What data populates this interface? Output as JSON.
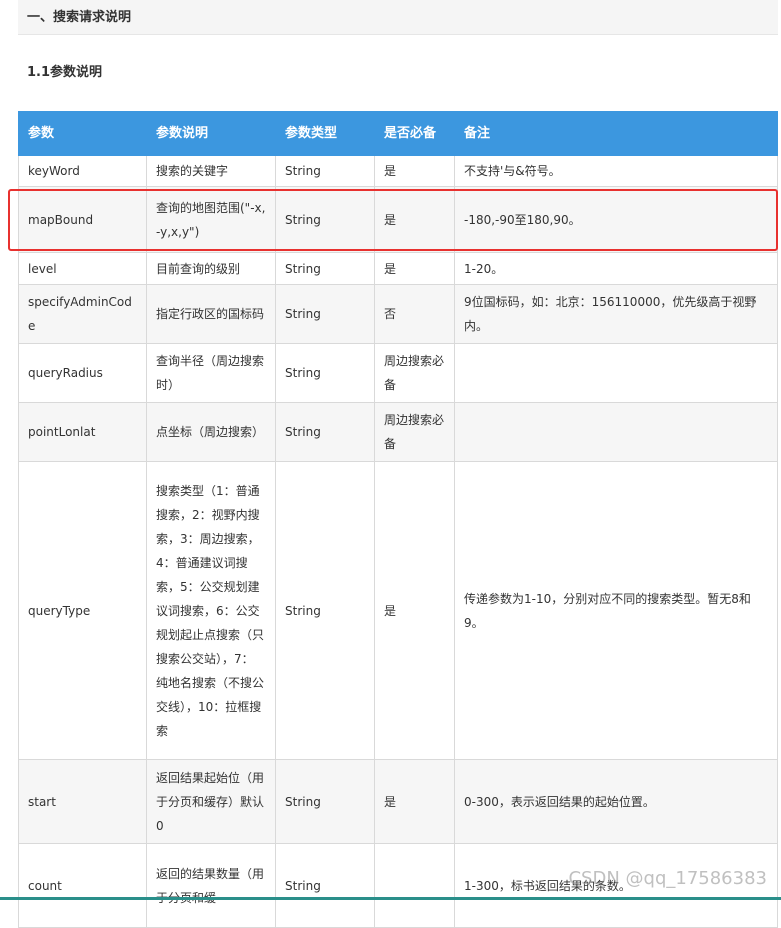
{
  "section_title": "一、搜索请求说明",
  "subsection_title": "1.1参数说明",
  "table": {
    "headers": [
      "参数",
      "参数说明",
      "参数类型",
      "是否必备",
      "备注"
    ],
    "rows": [
      {
        "name": "keyWord",
        "desc": "搜索的关键字",
        "type": "String",
        "required": "是",
        "note": "不支持'与&符号。"
      },
      {
        "name": "mapBound",
        "desc": "查询的地图范围(\"-x,-y,x,y\")",
        "type": "String",
        "required": "是",
        "note": "-180,-90至180,90。"
      },
      {
        "name": "level",
        "desc": "目前查询的级别",
        "type": "String",
        "required": "是",
        "note": "1-20。"
      },
      {
        "name": "specifyAdminCode",
        "desc": "指定行政区的国标码",
        "type": "String",
        "required": "否",
        "note": "9位国标码，如：北京：156110000，优先级高于视野内。"
      },
      {
        "name": "queryRadius",
        "desc": "查询半径（周边搜索时）",
        "type": "String",
        "required": "周边搜索必备",
        "note": ""
      },
      {
        "name": "pointLonlat",
        "desc": "点坐标（周边搜索）",
        "type": "String",
        "required": "周边搜索必备",
        "note": ""
      },
      {
        "name": "queryType",
        "desc": "搜索类型（1：普通搜索，2：视野内搜索，3：周边搜索，4：普通建议词搜索，5：公交规划建议词搜索，6：公交规划起止点搜索（只搜索公交站），7： 纯地名搜索（不搜公交线），10：拉框搜索",
        "type": "String",
        "required": "是",
        "note": "传递参数为1-10，分别对应不同的搜索类型。暂无8和9。"
      },
      {
        "name": "start",
        "desc": "返回结果起始位（用于分页和缓存）默认0",
        "type": "String",
        "required": "是",
        "note": "0-300，表示返回结果的起始位置。"
      },
      {
        "name": "count",
        "desc": "返回的结果数量（用于分页和缓",
        "type": "String",
        "required": "",
        "note": "1-300，标书返回结果的条数。"
      }
    ]
  },
  "watermark": "CSDN @qq_17586383",
  "colors": {
    "header_bg": "#3c97df",
    "highlight": "#e8312f"
  }
}
